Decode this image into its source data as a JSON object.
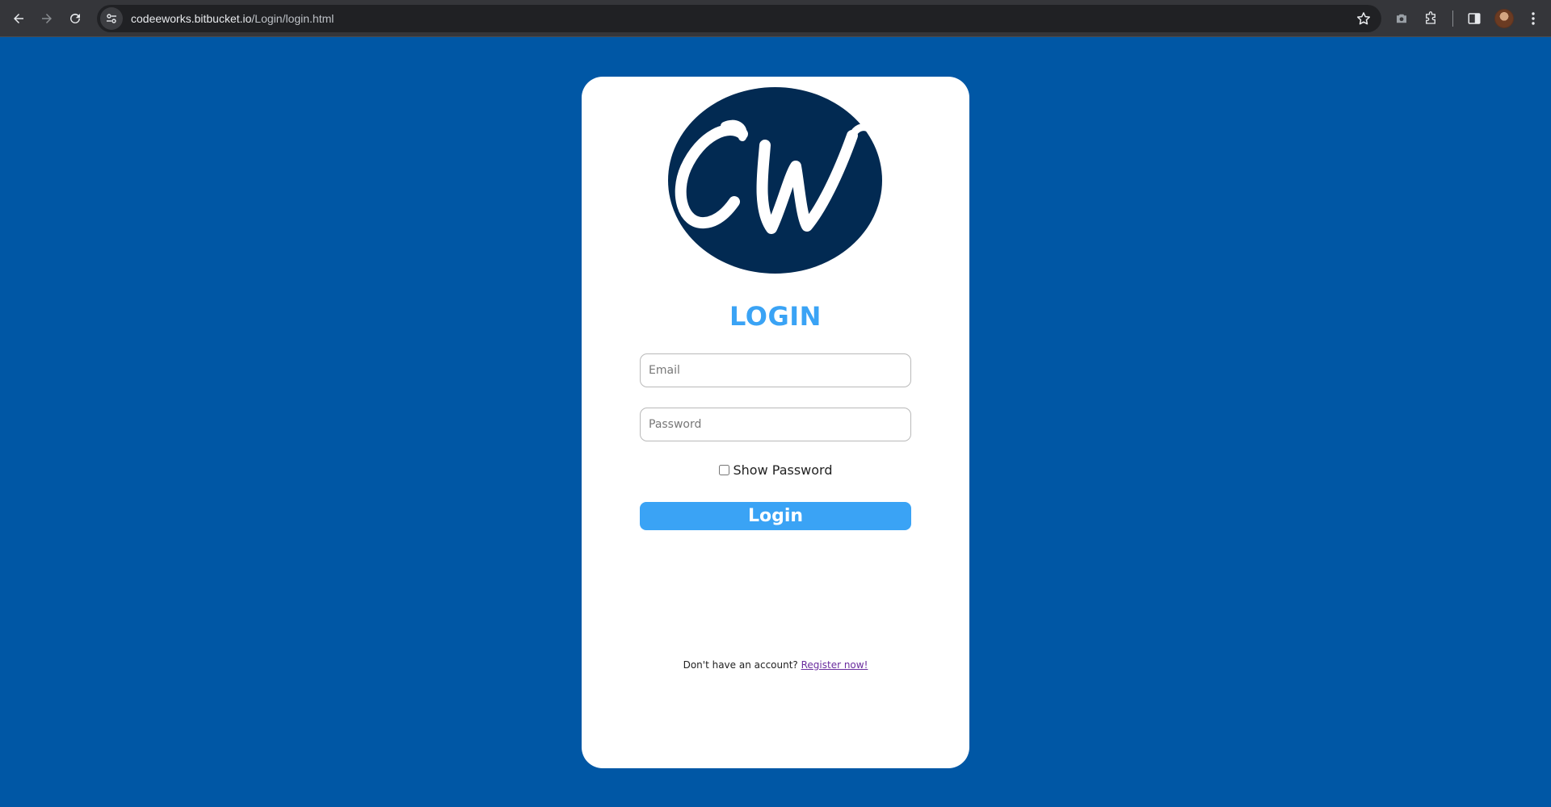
{
  "browser": {
    "url_host": "codeeworks.bitbucket.io",
    "url_path": "/Login/login.html"
  },
  "logo": {
    "text": "CW",
    "colors": {
      "circle": "#022a52",
      "letters": "#ffffff"
    }
  },
  "form": {
    "title": "LOGIN",
    "email_placeholder": "Email",
    "email_value": "",
    "password_placeholder": "Password",
    "password_value": "",
    "show_password_label": "Show Password",
    "show_password_checked": false,
    "login_button": "Login"
  },
  "footer": {
    "prompt": "Don't have an account? ",
    "register_link": "Register now!"
  },
  "colors": {
    "page_background": "#0057a5",
    "card_background": "#ffffff",
    "accent": "#3aa3f5",
    "link": "#6a2d9e"
  }
}
